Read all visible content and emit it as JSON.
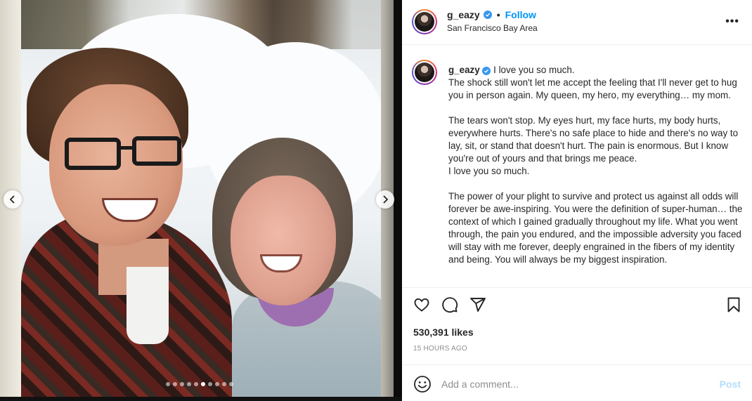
{
  "post": {
    "username": "g_eazy",
    "follow_label": "Follow",
    "separator": "•",
    "location": "San Francisco Bay Area",
    "more_label": "•••",
    "caption": "I love you so much.\nThe shock still won't let me accept the feeling that I'll never get to hug you in person again. My queen, my hero, my everything… my mom.\n\nThe tears won't stop. My eyes hurt, my face hurts, my body hurts, everywhere hurts. There's no safe place to hide and there's no way to lay, sit, or stand that doesn't hurt. The pain is enormous. But I know you're out of yours and that brings me peace.\nI love you so much.\n\nThe power of your plight to survive and protect us against all odds will forever be awe-inspiring. You were the definition of super-human… the context of which I gained gradually throughout my life. What you went through, the pain you endured, and the impossible adversity you faced will stay with me forever, deeply engrained in the fibers of my identity and being. You will always be my biggest inspiration.",
    "likes": "530,391 likes",
    "timestamp": "15 HOURS AGO"
  },
  "carousel": {
    "total_slides": 10,
    "active_index": 5
  },
  "comment": {
    "placeholder": "Add a comment...",
    "post_label": "Post"
  },
  "colors": {
    "follow_blue": "#0095f6",
    "verified_blue": "#3897f0",
    "post_disabled": "#b2dffc",
    "muted_text": "#8e8e8e"
  },
  "icons": [
    "chevron-left-icon",
    "chevron-right-icon",
    "verified-badge-icon",
    "more-options-icon",
    "heart-icon",
    "comment-icon",
    "share-icon",
    "bookmark-icon",
    "emoji-icon"
  ]
}
